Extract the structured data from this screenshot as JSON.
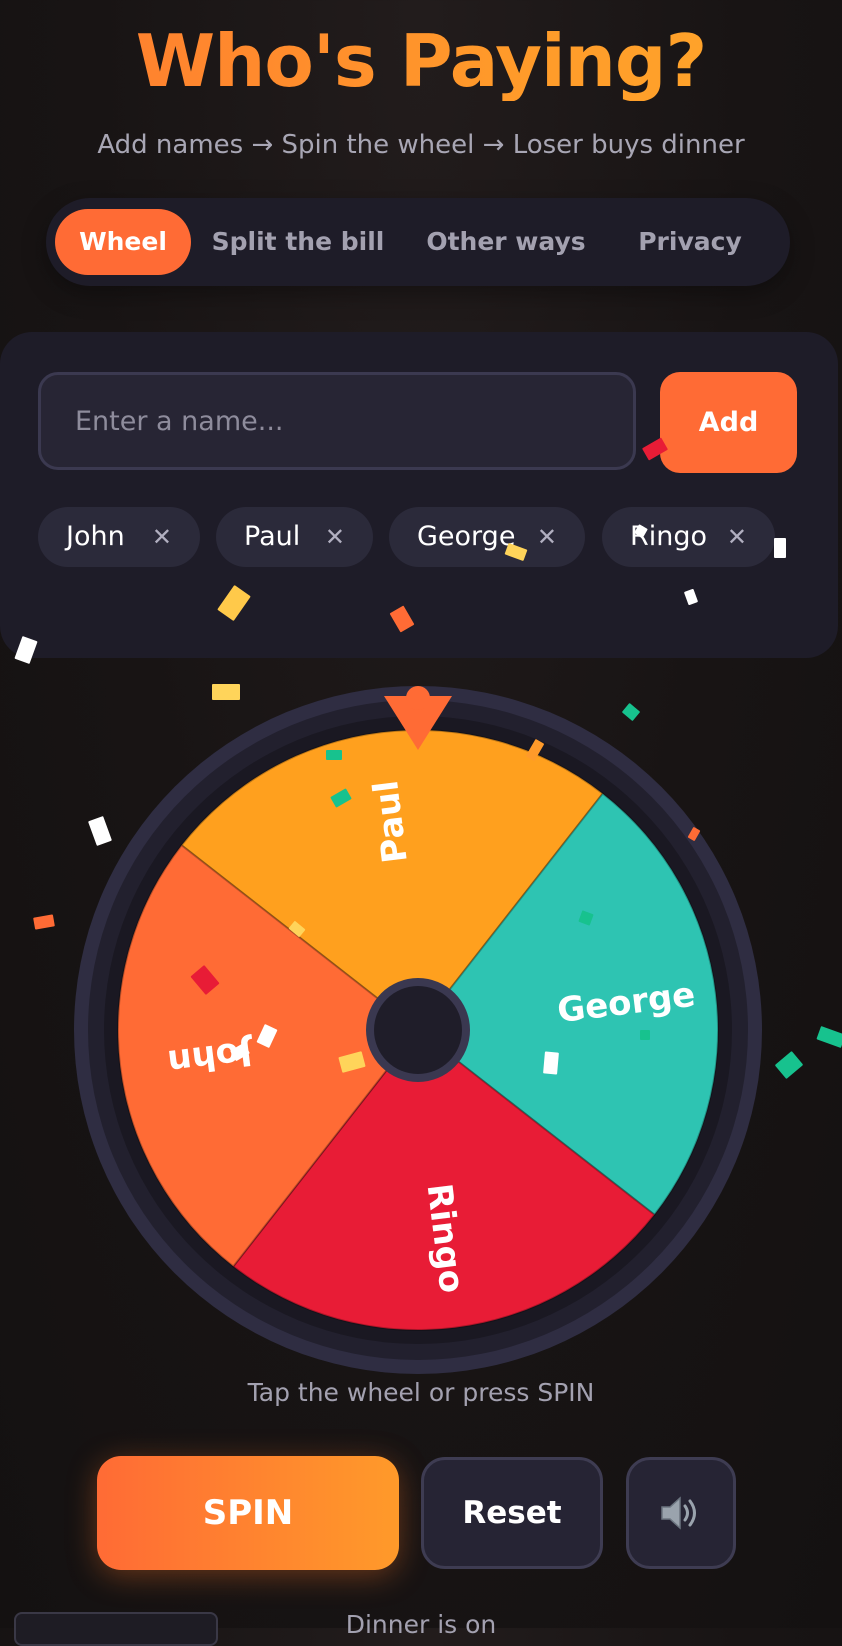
{
  "header": {
    "title": "Who's Paying?",
    "subtitle": "Add names → Spin the wheel → Loser buys dinner"
  },
  "tabs": [
    {
      "label": "Wheel",
      "active": true
    },
    {
      "label": "Split the bill",
      "active": false
    },
    {
      "label": "Other ways",
      "active": false
    },
    {
      "label": "Privacy",
      "active": false
    }
  ],
  "name_entry": {
    "placeholder": "Enter a name...",
    "value": "",
    "add_label": "Add"
  },
  "names": [
    {
      "label": "John",
      "remove_glyph": "✕"
    },
    {
      "label": "Paul",
      "remove_glyph": "✕"
    },
    {
      "label": "George",
      "remove_glyph": "✕"
    },
    {
      "label": "Ringo",
      "remove_glyph": "✕"
    }
  ],
  "wheel": {
    "segments": [
      {
        "label": "Paul",
        "color": "#ffa01e"
      },
      {
        "label": "George",
        "color": "#2ec4b2"
      },
      {
        "label": "Ringo",
        "color": "#e81c36"
      },
      {
        "label": "John",
        "color": "#ff6b35"
      }
    ],
    "pointer_color": "#ff6b35",
    "hint": "Tap the wheel or press SPIN"
  },
  "controls": {
    "spin_label": "SPIN",
    "reset_label": "Reset",
    "sound_icon": "speaker-icon"
  },
  "footer": {
    "text": "Dinner is on"
  },
  "colors": {
    "accent": "#ff6b35",
    "accent_end": "#ff9a2a",
    "background": "#181414",
    "card": "#1e1c28"
  }
}
